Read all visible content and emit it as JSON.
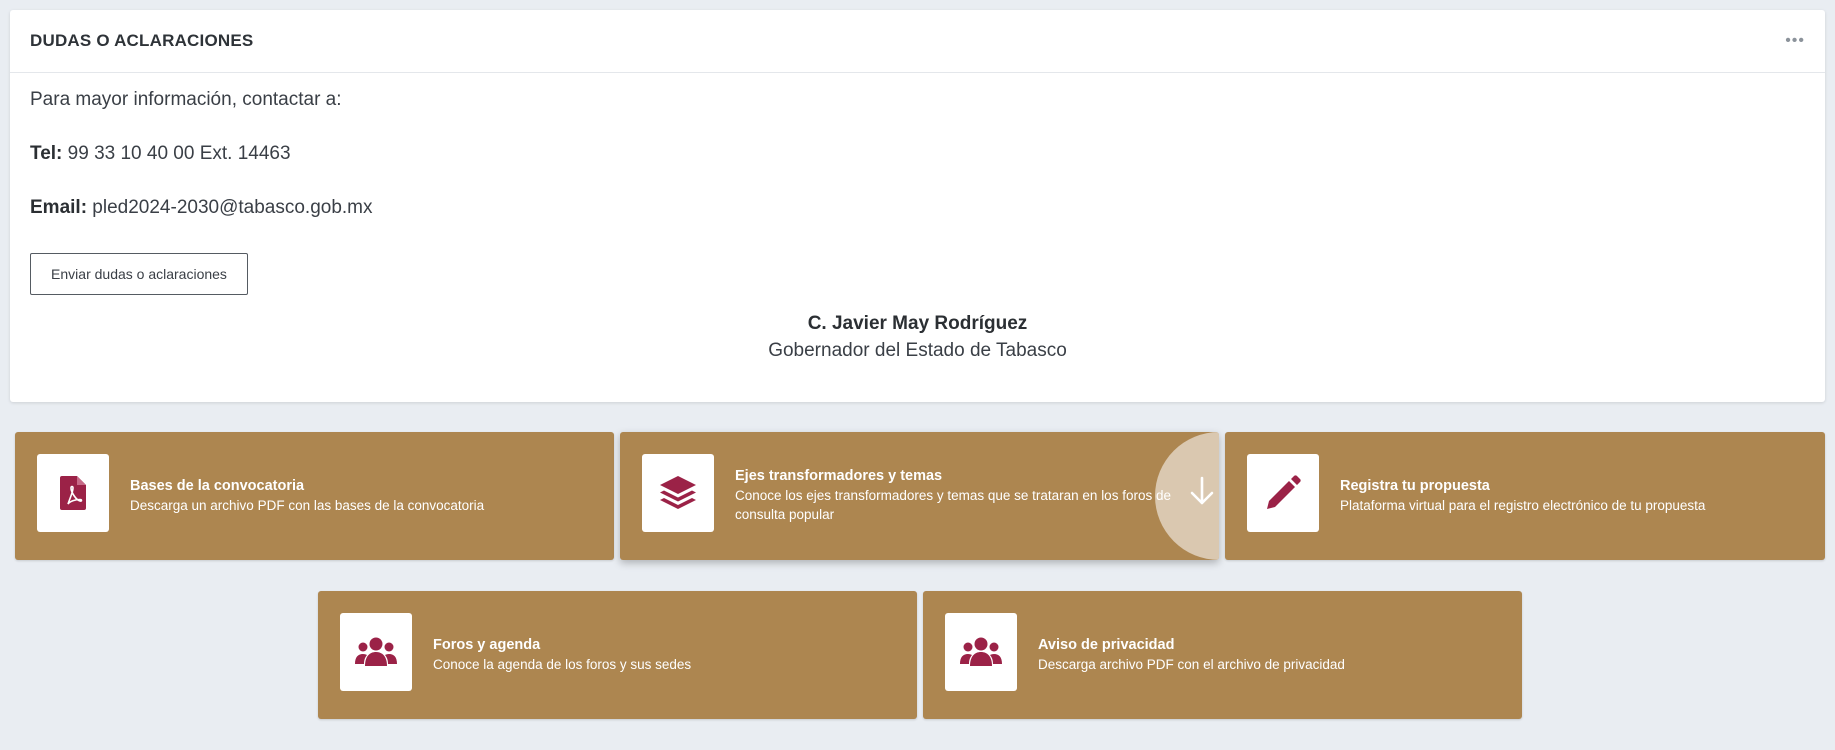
{
  "panel": {
    "title": "DUDAS O ACLARACIONES",
    "menu": "•••",
    "intro": "Para mayor información, contactar a:",
    "tel_label": "Tel:",
    "tel_value": " 99 33 10 40 00 Ext. 14463",
    "email_label": "Email:",
    "email_value": " pled2024-2030@tabasco.gob.mx",
    "button_label": "Enviar dudas o aclaraciones",
    "signature_name": "C. Javier May Rodríguez",
    "signature_role": "Gobernador del Estado de Tabasco"
  },
  "cards": [
    {
      "title": "Bases de la convocatoria",
      "desc": "Descarga un archivo PDF con las bases de la convocatoria",
      "icon": "pdf-file-icon"
    },
    {
      "title": "Ejes transformadores y temas",
      "desc": "Conoce los ejes transformadores y temas que se trataran en los foros de consulta popular",
      "icon": "layers-icon"
    },
    {
      "title": "Registra tu propuesta",
      "desc": "Plataforma virtual para el registro electrónico de tu propuesta",
      "icon": "pencil-icon"
    },
    {
      "title": "Foros y agenda",
      "desc": "Conoce la agenda de los foros y sus sedes",
      "icon": "users-icon"
    },
    {
      "title": "Aviso de privacidad",
      "desc": "Descarga archivo PDF con el archivo de privacidad",
      "icon": "users-icon"
    }
  ],
  "colors": {
    "card_bg": "#ad8650",
    "icon_color": "#9b2247",
    "page_bg": "#e9edf2"
  }
}
